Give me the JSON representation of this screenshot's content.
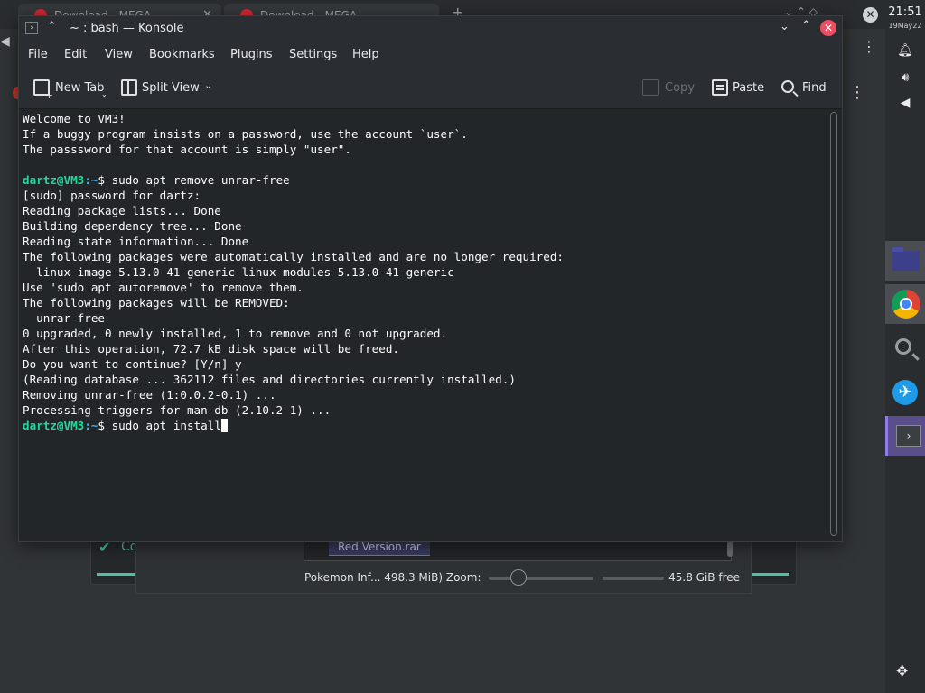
{
  "background": {
    "tabs": [
      {
        "label": "Download - MEGA"
      },
      {
        "label": "Download - MEGA"
      }
    ],
    "newtab_label": "+",
    "status_chip_label": "Co",
    "file_item": "Red Version.rar",
    "status_text": "Pokemon Inf... 498.3 MiB) Zoom:",
    "free_space": "45.8 GiB free"
  },
  "system_panel": {
    "time": "21:51",
    "date": "19May22"
  },
  "window": {
    "title": "~ : bash — Konsole",
    "menu": [
      "File",
      "Edit",
      "View",
      "Bookmarks",
      "Plugins",
      "Settings",
      "Help"
    ],
    "toolbar": {
      "new_tab": "New Tab",
      "split_view": "Split View",
      "copy": "Copy",
      "paste": "Paste",
      "find": "Find"
    }
  },
  "terminal": {
    "prompt_user": "dartz@VM3",
    "prompt_path": ":~",
    "prompt_symbol": "$",
    "lines": [
      "Welcome to VM3!",
      "If a buggy program insists on a password, use the account `user`.",
      "The passsword for that account is simply \"user\".",
      "",
      " sudo apt remove unrar-free",
      "[sudo] password for dartz:",
      "Reading package lists... Done",
      "Building dependency tree... Done",
      "Reading state information... Done",
      "The following packages were automatically installed and are no longer required:",
      "  linux-image-5.13.0-41-generic linux-modules-5.13.0-41-generic",
      "Use 'sudo apt autoremove' to remove them.",
      "The following packages will be REMOVED:",
      "  unrar-free",
      "0 upgraded, 0 newly installed, 1 to remove and 0 not upgraded.",
      "After this operation, 72.7 kB disk space will be freed.",
      "Do you want to continue? [Y/n] y",
      "(Reading database ... 362112 files and directories currently installed.)",
      "Removing unrar-free (1:0.0.2-0.1) ...",
      "Processing triggers for man-db (2.10.2-1) ...",
      " sudo apt install"
    ]
  }
}
